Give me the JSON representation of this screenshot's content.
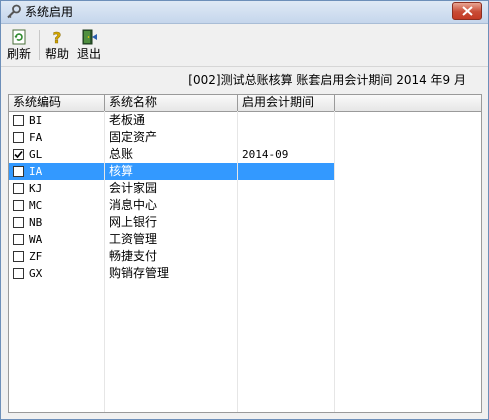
{
  "window": {
    "title": "系统启用"
  },
  "toolbar": {
    "refresh_label": "刷新",
    "help_label": "帮助",
    "exit_label": "退出"
  },
  "info_text": "[002]测试总账核算 账套启用会计期间 2014 年9 月",
  "columns": [
    "系统编码",
    "系统名称",
    "启用会计期间"
  ],
  "rows": [
    {
      "code": "BI",
      "name": "老板通",
      "period": "",
      "checked": false
    },
    {
      "code": "FA",
      "name": "固定资产",
      "period": "",
      "checked": false
    },
    {
      "code": "GL",
      "name": "总账",
      "period": "2014-09",
      "checked": true
    },
    {
      "code": "IA",
      "name": "核算",
      "period": "",
      "checked": false,
      "selected": true
    },
    {
      "code": "KJ",
      "name": "会计家园",
      "period": "",
      "checked": false
    },
    {
      "code": "MC",
      "name": "消息中心",
      "period": "",
      "checked": false
    },
    {
      "code": "NB",
      "name": "网上银行",
      "period": "",
      "checked": false
    },
    {
      "code": "WA",
      "name": "工资管理",
      "period": "",
      "checked": false
    },
    {
      "code": "ZF",
      "name": "畅捷支付",
      "period": "",
      "checked": false
    },
    {
      "code": "GX",
      "name": "购销存管理",
      "period": "",
      "checked": false
    }
  ]
}
